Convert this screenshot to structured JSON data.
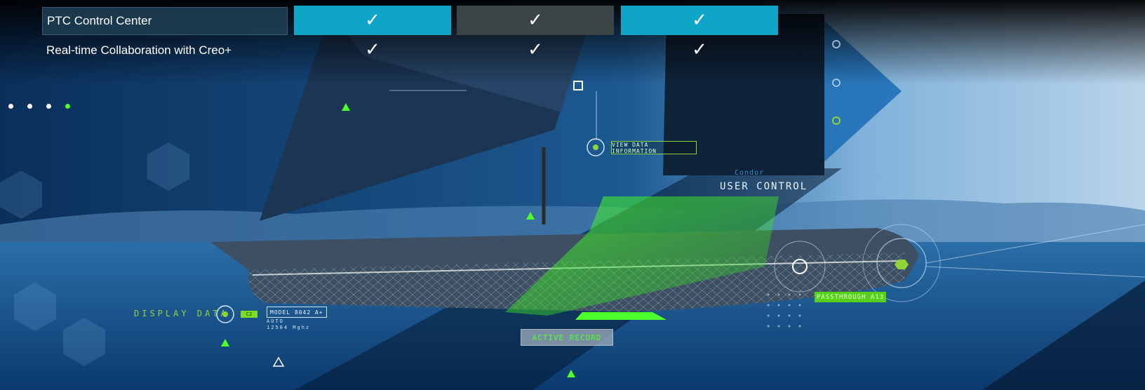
{
  "table": {
    "rows": [
      {
        "label": "PTC Control Center",
        "checks": [
          "✓",
          "✓",
          "✓"
        ]
      },
      {
        "label": "Real-time Collaboration with Creo+",
        "checks": [
          "✓",
          "✓",
          "✓"
        ]
      }
    ],
    "column_colors": [
      "#0ea5c6",
      "#3d4446",
      "#0ea5c6"
    ]
  },
  "hud": {
    "view_data_button": "VIEW DATA INFORMATION",
    "user_control_sub": "Condor",
    "user_control": "USER CONTROL",
    "display_data": "DISPLAY DATA",
    "badge_c2": "C2",
    "model": "MODEL 8042 A+",
    "meta_1": "AUTO",
    "meta_2": "12504 Mghz",
    "active_record": "ACTIVE RECORD",
    "passthrough": "PASSTHROUGH A13"
  },
  "carousel": {
    "slide_count": 4,
    "active_index": 3
  },
  "colors": {
    "accent_green": "#4cff2a",
    "accent_teal": "#0ea5c6",
    "hud_green": "#8fd43a"
  }
}
